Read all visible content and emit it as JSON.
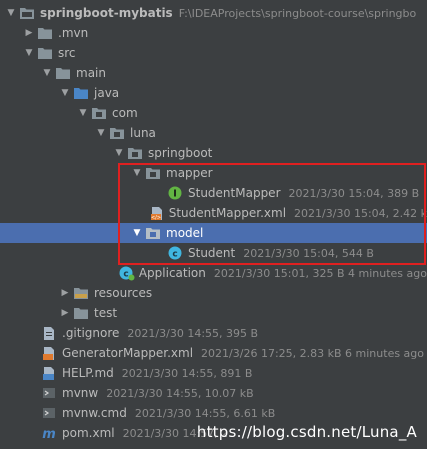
{
  "project": {
    "name": "springboot-mybatis",
    "path": "F:\\IDEAProjects\\springboot-course\\springbo"
  },
  "items": [
    {
      "label": ".mvn"
    },
    {
      "label": "src"
    },
    {
      "label": "main"
    },
    {
      "label": "java"
    },
    {
      "label": "com"
    },
    {
      "label": "luna"
    },
    {
      "label": "springboot"
    },
    {
      "label": "mapper"
    },
    {
      "label": "StudentMapper",
      "meta": "2021/3/30 15:04, 389 B"
    },
    {
      "label": "StudentMapper.xml",
      "meta": "2021/3/30 15:04, 2.42 k"
    },
    {
      "label": "model"
    },
    {
      "label": "Student",
      "meta": "2021/3/30 15:04, 544 B"
    },
    {
      "label": "Application",
      "meta": "2021/3/30 15:01, 325 B 4 minutes ago"
    },
    {
      "label": "resources"
    },
    {
      "label": "test"
    },
    {
      "label": ".gitignore",
      "meta": "2021/3/30 14:55, 395 B"
    },
    {
      "label": "GeneratorMapper.xml",
      "meta": "2021/3/26 17:25, 2.83 kB 6 minutes ago"
    },
    {
      "label": "HELP.md",
      "meta": "2021/3/30 14:55, 891 B"
    },
    {
      "label": "mvnw",
      "meta": "2021/3/30 14:55, 10.07 kB"
    },
    {
      "label": "mvnw.cmd",
      "meta": "2021/3/30 14:55, 6.61 kB"
    },
    {
      "label": "pom.xml",
      "meta": "2021/3/30 14:57, 2."
    }
  ],
  "watermark": "https://blog.csdn.net/Luna_A",
  "colors": {
    "background": "#3c3f41",
    "selection": "#4b6eaf",
    "highlight_border": "#e02020",
    "folder": "#87939a",
    "interface_icon": "#62b543",
    "class_icon": "#40b6e0"
  }
}
